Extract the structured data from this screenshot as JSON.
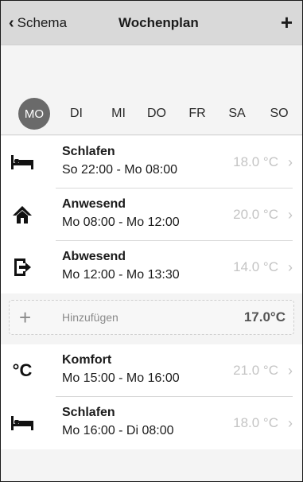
{
  "nav": {
    "back_label": "Schema",
    "title": "Wochenplan",
    "add_label": "+"
  },
  "days": [
    "MO",
    "DI",
    "MI",
    "DO",
    "FR",
    "SA",
    "SO"
  ],
  "active_day": "MO",
  "entries_top": [
    {
      "icon": "bed-icon",
      "title": "Schlafen",
      "time": "So 22:00 - Mo 08:00",
      "temp": "18.0 °C"
    },
    {
      "icon": "home-icon",
      "title": "Anwesend",
      "time": "Mo 08:00 - Mo 12:00",
      "temp": "20.0 °C"
    },
    {
      "icon": "exit-icon",
      "title": "Abwesend",
      "time": "Mo 12:00 - Mo 13:30",
      "temp": "14.0 °C"
    }
  ],
  "add_slot": {
    "label": "Hinzufügen",
    "temp": "17.0°C"
  },
  "entries_bottom": [
    {
      "icon": "celsius-icon",
      "icon_text": "°C",
      "title": "Komfort",
      "time": "Mo 15:00 - Mo 16:00",
      "temp": "21.0 °C"
    },
    {
      "icon": "bed-icon",
      "title": "Schlafen",
      "time": "Mo 16:00 - Di 08:00",
      "temp": "18.0 °C"
    }
  ],
  "chevron": "›",
  "colors": {
    "nav_bg": "#d9d9d9",
    "active_day_bg": "#6a6a6a",
    "temp_text": "#c4c4c4"
  }
}
